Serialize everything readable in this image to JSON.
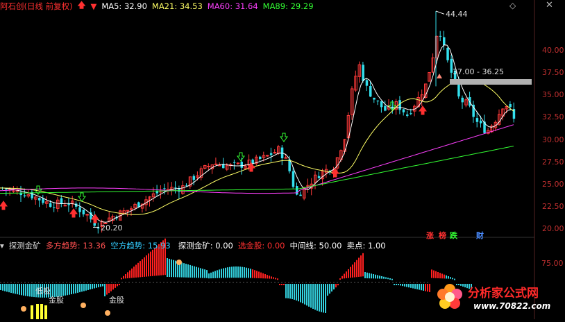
{
  "header": {
    "title": "阿石创(日线 前复权)",
    "ma5": "MA5: 32.90",
    "ma21": "MA21: 34.53",
    "ma60": "MA60: 31.64",
    "ma89": "MA89: 29.29",
    "colors": {
      "title": "#ff3030",
      "ma5": "#ffffff",
      "ma21": "#ffff66",
      "ma60": "#ff40ff",
      "ma89": "#33ff33"
    }
  },
  "price_axis": [
    "40.00",
    "37.50",
    "35.00",
    "32.50",
    "30.00",
    "27.50",
    "25.00",
    "22.50",
    "20.00"
  ],
  "annotations": {
    "high": "44.44",
    "low": "20.20",
    "range_box": "37.00 - 36.25"
  },
  "badges": {
    "rise": "涨",
    "list": "榜",
    "fall": "跌",
    "finance": "财"
  },
  "indicator_header": {
    "name": "探测金矿",
    "long_trend_label": "多方趋势:",
    "long_trend_value": "13.36",
    "short_trend_label": "空方趋势:",
    "short_trend_value": "15.93",
    "detect_label": "探测金矿:",
    "detect_value": "0.00",
    "select_label": "选金股:",
    "select_value": "0.00",
    "mid_label": "中间线:",
    "mid_value": "50.00",
    "sell_label": "卖点:",
    "sell_value": "1.00"
  },
  "indicator_axis": [
    "75.00"
  ],
  "indicator_labels": {
    "low_buy": "低吸",
    "gold1": "金股",
    "gold2": "金股"
  },
  "watermark": {
    "brand": "分析家公式网",
    "url": "www.70822.com"
  },
  "chart_data": {
    "type": "candlestick",
    "ylim": [
      19,
      45
    ],
    "high": 44.44,
    "low": 20.2
  }
}
